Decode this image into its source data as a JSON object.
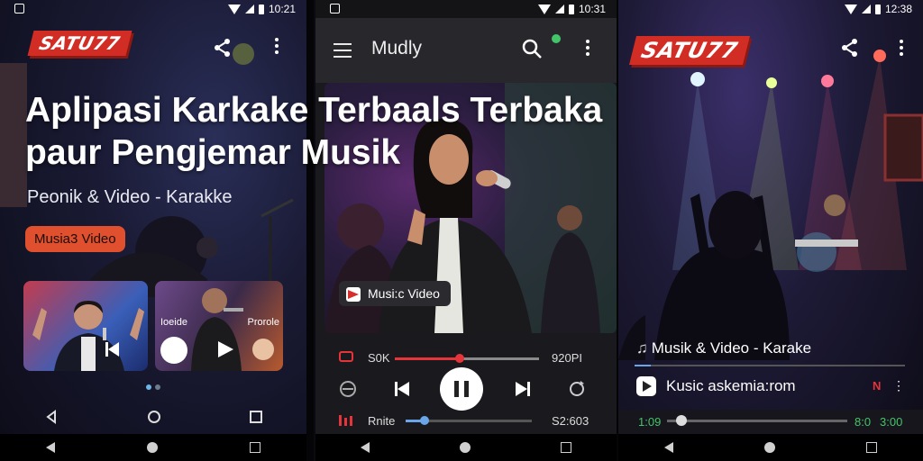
{
  "panel1": {
    "status_time": "10:21",
    "logo": "SATU77",
    "headline_line1": "Aplipasi Karkake",
    "headline_overflow": "Terbaals Terbaka",
    "headline_line2": "paur Pengjemar Musik",
    "subtitle": "Peonik & Video - Karakke",
    "pill_label": "Musia3 Video",
    "thumb2_left_label": "Ioeide",
    "thumb2_right_label": "Prorole"
  },
  "panel2": {
    "status_time": "10:31",
    "app_title": "Mudly",
    "chip_label": "Musi:c Video",
    "row1_left": "S0K",
    "row1_time": "920PI",
    "row3_label": "Rnite",
    "row3_time": "S2:603",
    "progress_fraction": 0.45,
    "volume_fraction": 0.15,
    "accent": "#e6353a"
  },
  "panel3": {
    "status_time": "12:38",
    "logo": "SATU77",
    "track_title": "Musik & Video - Karake",
    "source_label": "Kusic askemia:rom",
    "time_start": "1:09",
    "time_mid": "8:0",
    "time_end": "3:00",
    "seek_fraction": 0.08,
    "accent": "#43c46a"
  },
  "icons": [
    "search-icon",
    "share-icon",
    "menu-icon",
    "more-vert-icon",
    "play-icon",
    "pause-icon",
    "previous-icon",
    "next-icon",
    "repeat-icon",
    "shuffle-icon",
    "back-icon",
    "home-icon",
    "recents-icon"
  ]
}
